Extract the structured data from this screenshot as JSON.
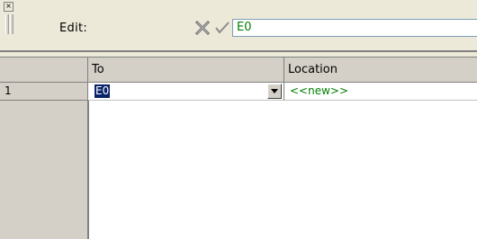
{
  "toolbar": {
    "close_glyph": "×",
    "edit_label": "Edit:",
    "cancel_icon": "cancel-x-icon",
    "accept_icon": "accept-check-icon",
    "edit_value": "E0"
  },
  "grid": {
    "columns": [
      "To",
      "Location"
    ],
    "rows": [
      {
        "index": "1",
        "to": "E0",
        "location": "<<new>>"
      }
    ]
  },
  "colors": {
    "toolbar_bg": "#ece9d8",
    "header_bg": "#d4d0c8",
    "selection_bg": "#0a246a",
    "new_text": "#008000"
  }
}
